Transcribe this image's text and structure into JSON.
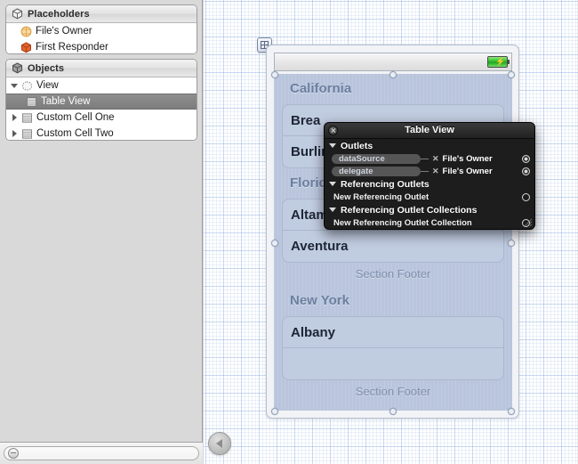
{
  "sidebar": {
    "placeholders_panel": {
      "title": "Placeholders",
      "icon": "cube-outline-icon",
      "items": [
        {
          "label": "File's Owner",
          "icon": "files-owner-icon"
        },
        {
          "label": "First Responder",
          "icon": "first-responder-icon"
        }
      ]
    },
    "objects_panel": {
      "title": "Objects",
      "icon": "cube-solid-icon",
      "items": [
        {
          "label": "View",
          "icon": "view-icon",
          "indent": 0,
          "disclosure": "open",
          "selected": false
        },
        {
          "label": "Table View",
          "icon": "table-view-icon",
          "indent": 1,
          "disclosure": "none",
          "selected": true
        },
        {
          "label": "Custom Cell One",
          "icon": "table-cell-icon",
          "indent": 0,
          "disclosure": "closed",
          "selected": false
        },
        {
          "label": "Custom Cell Two",
          "icon": "table-cell-icon",
          "indent": 0,
          "disclosure": "closed",
          "selected": false
        }
      ]
    },
    "zoom_slider": {
      "name": "zoom-slider",
      "value": 0
    }
  },
  "canvas": {
    "back_button": "back-arrow-button",
    "view_badge": "view-anchor-badge",
    "status_bar": {
      "battery": "battery-icon"
    },
    "table_view": {
      "name": "Table View",
      "sections": [
        {
          "header": "California",
          "footer": "",
          "cells": [
            "Brea",
            "Burlingame"
          ]
        },
        {
          "header": "Florida",
          "footer": "Section Footer",
          "cells": [
            "Altamonte Springs",
            "Aventura"
          ]
        },
        {
          "header": "New York",
          "footer": "Section Footer",
          "cells": [
            "Albany",
            ""
          ]
        }
      ]
    }
  },
  "inspector": {
    "title": "Table View",
    "close_icon": "close-icon",
    "resize_grip": "resize-grip-icon",
    "groups": [
      {
        "heading": "Outlets",
        "rows": [
          {
            "name": "dataSource",
            "target": "File's Owner",
            "disconnect_icon": "x-icon",
            "connector": "filled"
          },
          {
            "name": "delegate",
            "target": "File's Owner",
            "disconnect_icon": "x-icon",
            "connector": "filled"
          }
        ]
      },
      {
        "heading": "Referencing Outlets",
        "rows": [
          {
            "name": "New Referencing Outlet",
            "target": "",
            "connector": "empty"
          }
        ]
      },
      {
        "heading": "Referencing Outlet Collections",
        "rows": [
          {
            "name": "New Referencing Outlet Collection",
            "target": "",
            "connector": "empty"
          }
        ]
      }
    ]
  },
  "colors": {
    "hud_bg": "#1d1d1d",
    "table_view_bg": "#b9c5dc",
    "cell_bg": "#c0cce0",
    "section_header_text": "#6b7fa0",
    "selection_row": "#7d7d7d",
    "grid_line": "#96b4e1"
  }
}
